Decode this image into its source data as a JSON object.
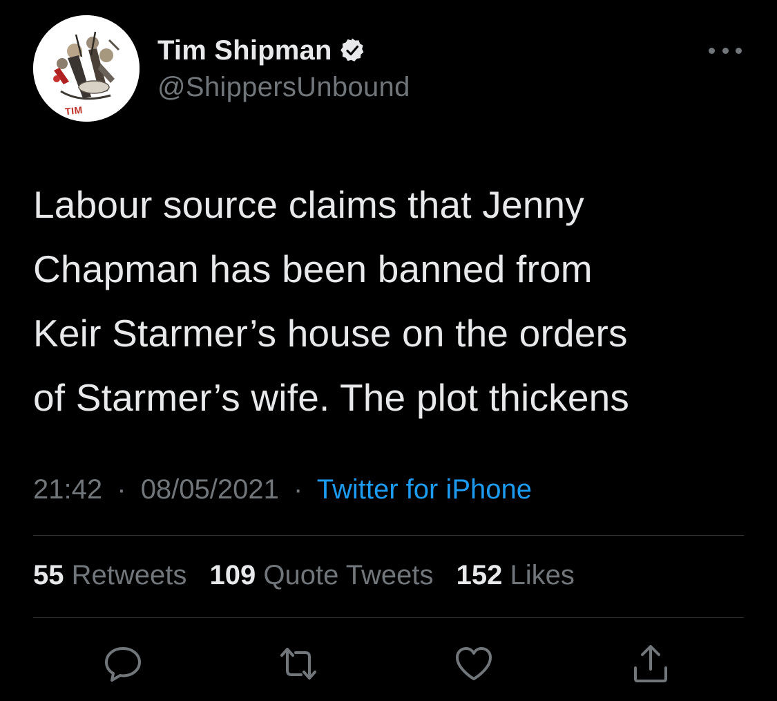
{
  "author": {
    "name": "Tim Shipman",
    "handle": "@ShippersUnbound",
    "avatar_label": "TIM",
    "verified": true
  },
  "tweet": {
    "text": "Labour source claims that Jenny\nChapman has been banned from\nKeir Starmer’s house on the orders\nof Starmer’s wife. The plot thickens",
    "time": "21:42",
    "date": "08/05/2021",
    "separator": "·",
    "source": "Twitter for iPhone"
  },
  "stats": {
    "retweets_count": "55",
    "retweets_label": "Retweets",
    "quotes_count": "109",
    "quotes_label": "Quote Tweets",
    "likes_count": "152",
    "likes_label": "Likes"
  },
  "actions": [
    "reply-icon",
    "retweet-icon",
    "like-icon",
    "share-icon"
  ],
  "colors": {
    "background": "#000000",
    "text": "#e7e9ea",
    "secondary": "#71767b",
    "link": "#1d9bf0",
    "divider": "#2f3336"
  }
}
